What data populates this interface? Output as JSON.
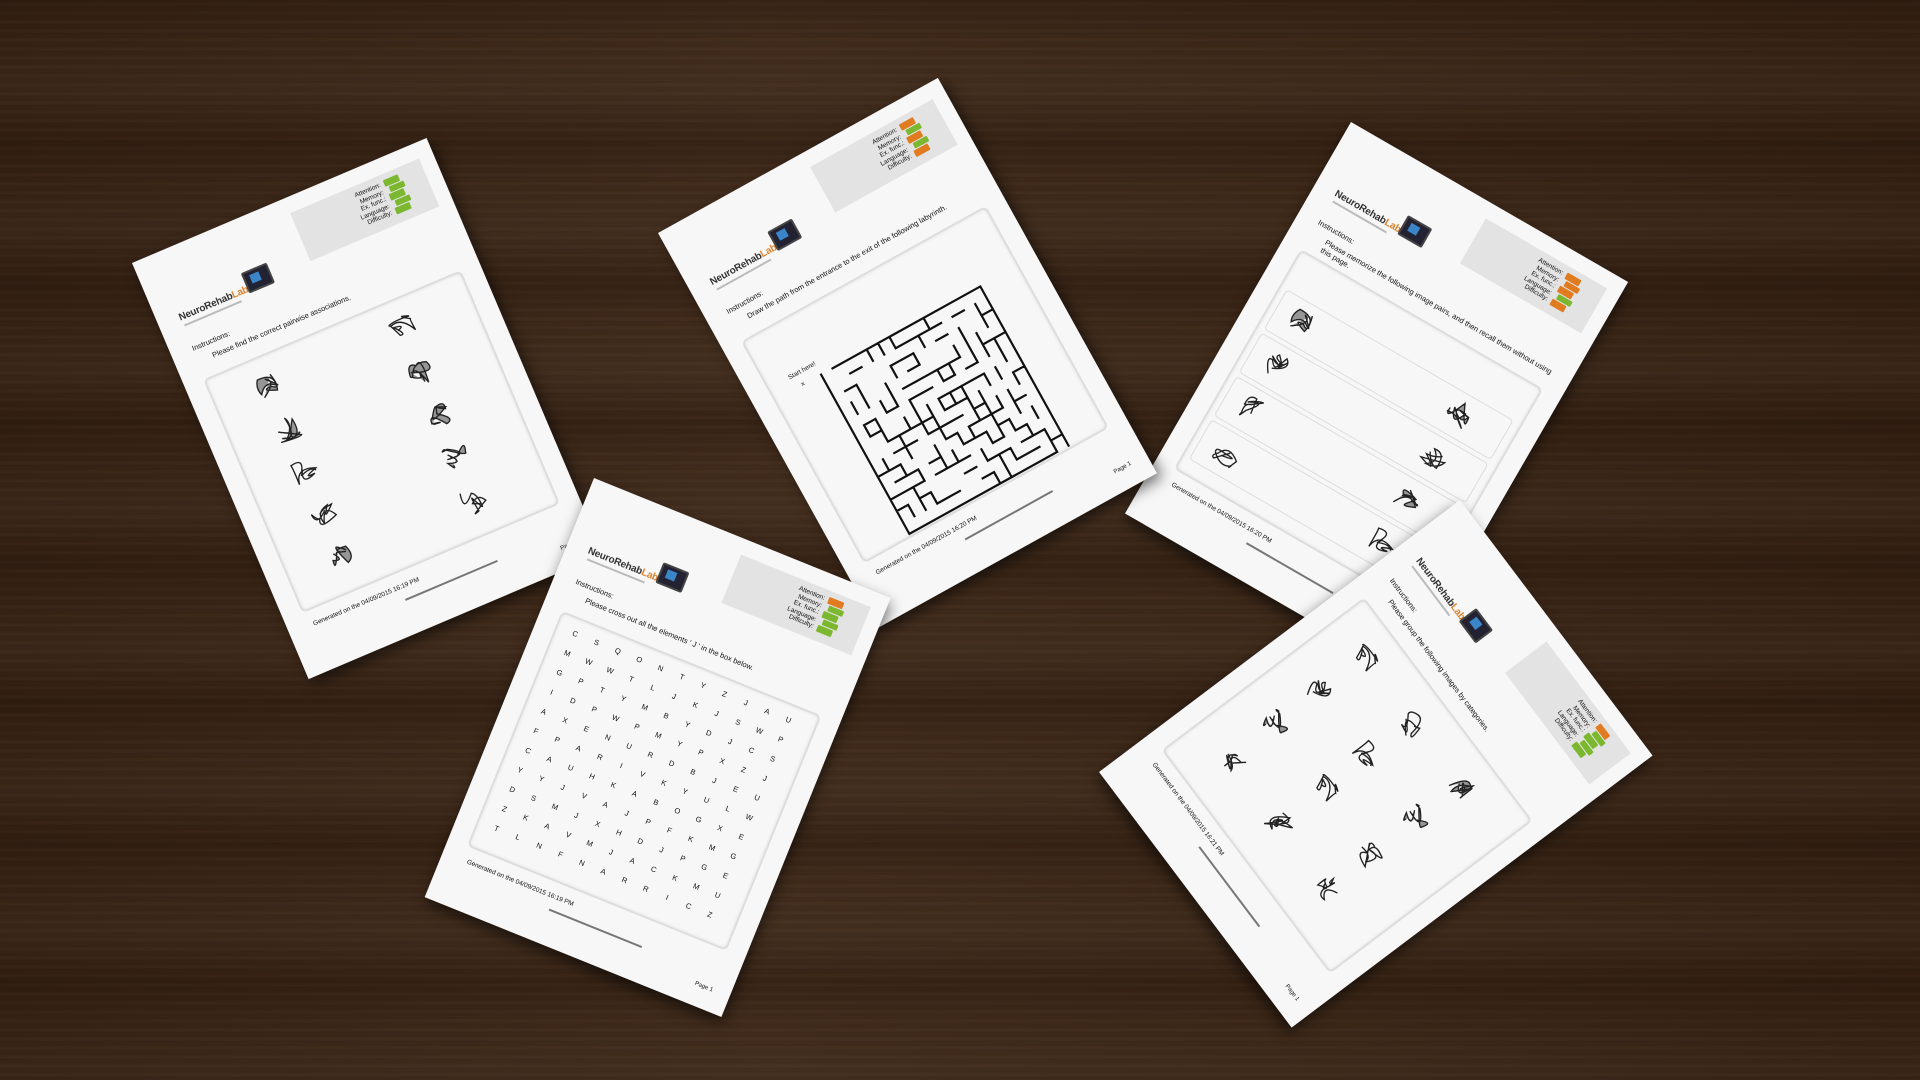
{
  "logo": {
    "main": "NeuroRehab",
    "accent": "Lab"
  },
  "rating_labels": [
    "Attention:",
    "Memory:",
    "Ex. func.:",
    "Language:",
    "Difficulty:"
  ],
  "colors": {
    "green": "#7cb82f",
    "orange": "#e07b1f"
  },
  "sheets": [
    {
      "type": "pairwise",
      "ratings": [
        "green",
        "green",
        "green",
        "green",
        "green"
      ],
      "instructions_label": "Instructions:",
      "instruction": "Please find the correct pairwise associations.",
      "pictures": [
        "pins-icon",
        "bell-icon",
        "ice-skate-icon",
        "hockey-stick-icon",
        "bread-icon",
        "toaster-icon",
        "dark-room-photo-icon",
        "pizza-icon",
        "helmet-icon",
        "motorcycle-icon"
      ],
      "generated": "Generated on the 04/09/2015 16:19 PM",
      "page": "Page 1"
    },
    {
      "type": "maze",
      "ratings": [
        "orange",
        "green",
        "orange",
        "green",
        "orange"
      ],
      "instructions_label": "Instructions:",
      "instruction": "Draw the path from the entrance to the exit of the following labyrinth.",
      "start_label": "Start here!",
      "start_mark": "x",
      "generated": "Generated on the 04/09/2015 16:20 PM",
      "page": "Page 1"
    },
    {
      "type": "wordsearch",
      "ratings": [
        "orange",
        "green",
        "green",
        "green",
        "green"
      ],
      "instructions_label": "Instructions:",
      "instruction": "Please cross out all the elements ' J ' in the box below.",
      "grid": [
        "CSQONTYZJAU",
        "MWWTLJKJSWP",
        "GPTYMBYDJCS",
        "IDPWPMYPXZJ",
        "AXENURDBJEU",
        "FPARIVKYULW",
        "CAUHKABOGXE",
        "YYJVAJPFKMG",
        "DSMJXHDJPGE",
        "ZKAVMJACKMU",
        "TLNFNARRICZ"
      ],
      "generated": "Generated on the 04/09/2015 16:19 PM",
      "page": "Page 1"
    },
    {
      "type": "memory",
      "ratings": [
        "orange",
        "orange",
        "orange",
        "green",
        "orange"
      ],
      "instructions_label": "Instructions:",
      "instruction": "Please memorize the following image pairs, and then recall them without using this page.",
      "pictures": [
        "branch-icon",
        "nail-icon",
        "person-icon",
        "feather-icon",
        "paintbrush-icon",
        "figure-icon",
        "lighthouse-icon",
        "broom-icon"
      ],
      "generated": "Generated on the 04/09/2015 16:20 PM",
      "page": "Page 1"
    },
    {
      "type": "categories",
      "ratings": [
        "orange",
        "green",
        "green",
        "green",
        "green"
      ],
      "instructions_label": "Instructions:",
      "instruction": "Please group the following images by categories.",
      "pictures": [
        "bird-icon",
        "roller-skate-icon",
        "saucepan-icon",
        "peapod-icon",
        "broom-icon",
        "panda-icon",
        "insect-icon",
        "boat-icon",
        "easel-icon",
        "leaves-icon",
        "vacuum-icon",
        "rabbit-icon"
      ],
      "generated": "Generated on the 04/09/2015 16:21 PM",
      "page": "Page 1"
    }
  ]
}
